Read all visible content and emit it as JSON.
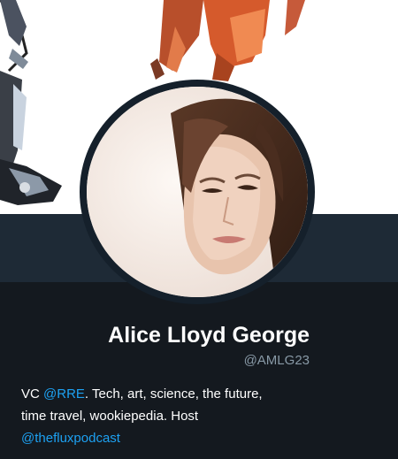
{
  "banner": {
    "image": "illustrated-figures-banner"
  },
  "avatar": {
    "image": "woman-portrait-photo"
  },
  "profile": {
    "name": "Alice Lloyd George",
    "handle": "@AMLG23",
    "bio": {
      "prefix": "VC ",
      "mention": "@RRE",
      "middle": ". Tech, art, science, the future,",
      "line2": "time travel, wookiepedia. Host",
      "link": "@thefluxpodcast"
    }
  },
  "colors": {
    "background": "#15202b",
    "strip": "#1e2a36",
    "profile_bg": "#14191f",
    "text": "#ffffff",
    "muted": "#8899a6",
    "link": "#1da1f2"
  }
}
